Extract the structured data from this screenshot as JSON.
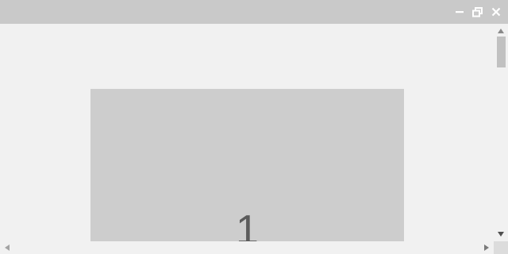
{
  "window": {
    "controls": [
      {
        "icon": "minimize-icon"
      },
      {
        "icon": "restore-icon"
      },
      {
        "icon": "close-icon"
      }
    ]
  },
  "slide": {
    "number": "1"
  },
  "colors": {
    "titlebar": "#c9c9c9",
    "background": "#f1f1f1",
    "slide": "#cdcdcd",
    "slide_text": "#5b5b5b",
    "scroll_thumb": "#c1c1c1"
  }
}
